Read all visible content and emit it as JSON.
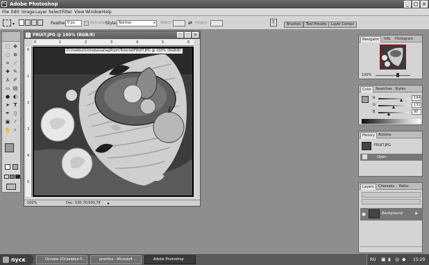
{
  "app": {
    "title": "Adobe Photoshop",
    "logo": "Ps"
  },
  "window_controls": {
    "minimize": "_",
    "maximize": "□",
    "close": "×"
  },
  "menu": [
    "File",
    "Edit",
    "Image",
    "Layer",
    "Select",
    "Filter",
    "View",
    "Window",
    "Help"
  ],
  "options": {
    "feather_label": "Feather:",
    "feather_value": "0 px",
    "antialias_label": "Anti-alias",
    "style_label": "Style:",
    "style_value": "Normal",
    "width_label": "Width:",
    "height_label": "Height:"
  },
  "palette_well": [
    "Brushes",
    "Tool Presets",
    "Layer Comps"
  ],
  "document": {
    "title": "FRUIT.JPG @ 100% (RGB/8)",
    "path_tooltip": "D:\\Inetbut\\Ucheba\\sal\\egProm\\Tutorial\\FRUIT.JPG @ 100% (RGB/8)",
    "zoom": "100%",
    "doc_info": "Doc: 530,7K/530,7K",
    "ruler_top": [
      "0",
      "1",
      "2",
      "3",
      "4",
      "5",
      "6"
    ],
    "ruler_left": [
      "0",
      "1",
      "2",
      "3",
      "4",
      "5"
    ]
  },
  "navigator": {
    "tabs": [
      "Navigator",
      "Info",
      "Histogram"
    ],
    "zoom": "100%"
  },
  "color": {
    "tabs": [
      "Color",
      "Swatches",
      "Styles"
    ],
    "channels": [
      {
        "label": "R",
        "value": "194",
        "level": 0.76
      },
      {
        "label": "G",
        "value": "131",
        "level": 0.51
      },
      {
        "label": "B",
        "value": "90",
        "level": 0.35
      }
    ]
  },
  "history": {
    "tabs": [
      "History",
      "Actions"
    ],
    "snapshot": "FRUIT.JPG",
    "step": "Open"
  },
  "layers": {
    "tabs": [
      "Layers",
      "Channels",
      "Paths"
    ],
    "layer": "Background"
  },
  "taskbar": {
    "start": "пуск",
    "tasks": [
      "Основи 2Dграфіки Р...",
      "practika - Microsoft ...",
      "Adobe Photoshop"
    ],
    "lang": "RU",
    "clock": "15:29"
  },
  "colors": {
    "chrome": "#d4d4d4",
    "workspace": "#8e8e8e",
    "titlebar": "#5a5a5a"
  }
}
